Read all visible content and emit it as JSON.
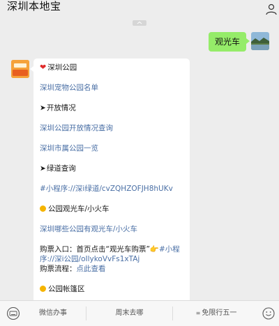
{
  "header": {
    "title": "深圳本地宝"
  },
  "outgoing": {
    "text": "观光车"
  },
  "bubble": {
    "lines": [
      "深圳公园",
      "深圳宠物公园名单",
      "开放情况",
      "深圳公园开放情况查询",
      "深圳市属公园一览",
      "绿道查询",
      "#小程序://深i绿道/cvZQHZOFJH8hUKv",
      "公园观光车/小火车",
      "深圳哪些公园有观光车/小火车",
      "购票入口：首页点击“观光车购票”",
      "#小程",
      "序://深i公园/oIlykoVvFs1xTAj",
      "购票流程：",
      "点此查看",
      "公园帐篷区"
    ]
  },
  "bot_avatar": {
    "top": "本地宝",
    "bottom": "深圳"
  },
  "bottom_menu": {
    "items": [
      "微信办事",
      "周末去哪",
      "免限行五一"
    ]
  },
  "icons": [
    "user-icon",
    "keyboard-icon",
    "emoji-icon",
    "heart-icon",
    "arrow-icon",
    "yellow-dot-icon",
    "pointing-hand-icon",
    "collapse-icon"
  ]
}
